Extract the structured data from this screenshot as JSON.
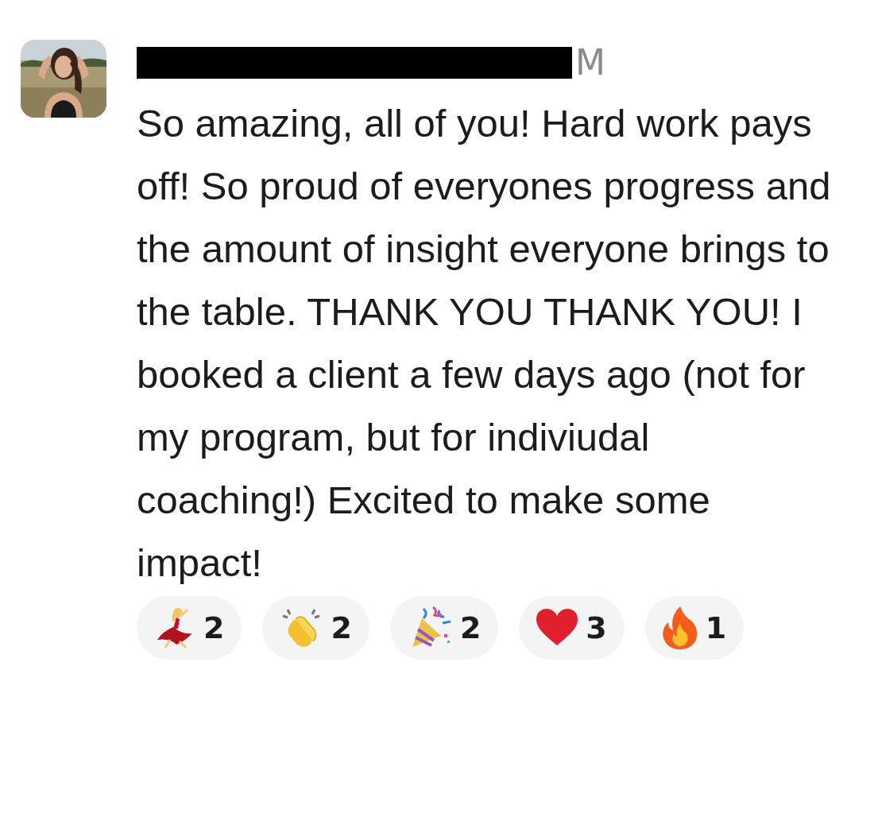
{
  "message": {
    "author_redacted": true,
    "time_visible": "M",
    "text": "So amazing, all of you! Hard work pays off! So proud of everyones progress and the amount of insight everyone brings to the table. THANK YOU THANK YOU! I booked a client a few days ago (not for my program, but for indiviudal coaching!) Excited to make some impact!",
    "reactions": [
      {
        "kind": "dancer",
        "count": "2"
      },
      {
        "kind": "clap",
        "count": "2"
      },
      {
        "kind": "party",
        "count": "2"
      },
      {
        "kind": "heart",
        "count": "3"
      },
      {
        "kind": "fire",
        "count": "1"
      }
    ]
  }
}
